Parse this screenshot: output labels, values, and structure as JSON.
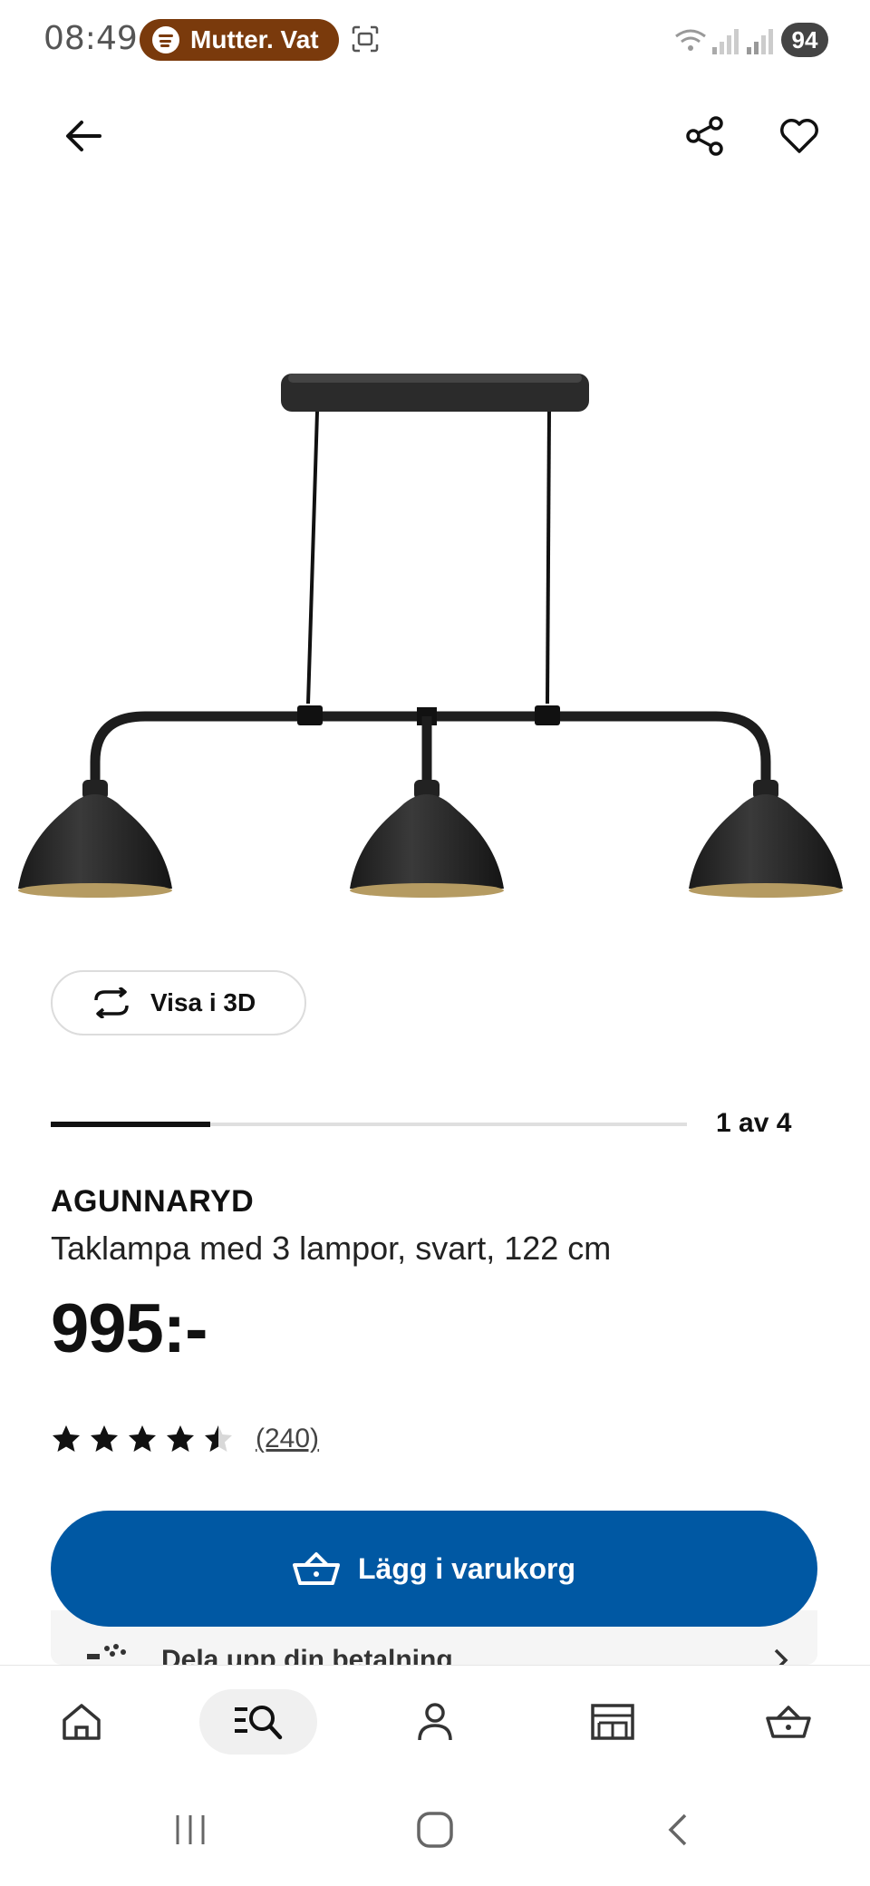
{
  "status_bar": {
    "time": "08:49",
    "media_pill": "Mutter. Vat",
    "battery": "94"
  },
  "product": {
    "view_3d_label": "Visa i 3D",
    "image_pager": "1 av 4",
    "image_progress": 0.25,
    "name": "AGUNNARYD",
    "description": "Taklampa med 3 lampor, svart, 122 cm",
    "price": "995:-",
    "rating": 4.5,
    "rating_max": 5,
    "review_count": "(240)"
  },
  "actions": {
    "add_to_cart": "Lägg i varukorg",
    "installment": "Dela upp din betalning"
  },
  "colors": {
    "primary": "#0058a3",
    "pill": "#7a3a0c"
  },
  "bottom_nav": [
    {
      "icon": "home-icon"
    },
    {
      "icon": "search-catalog-icon",
      "active": true
    },
    {
      "icon": "profile-icon"
    },
    {
      "icon": "store-icon"
    },
    {
      "icon": "cart-icon"
    }
  ]
}
